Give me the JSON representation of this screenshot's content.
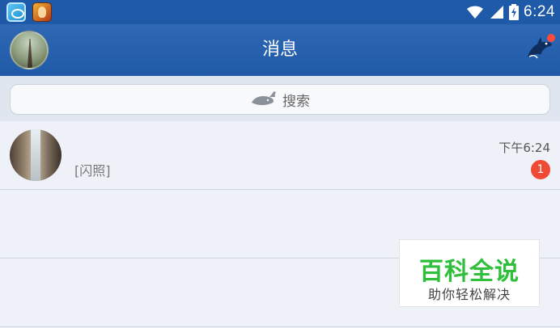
{
  "status_bar": {
    "time": "6:24",
    "apps": [
      "app-icon-1",
      "app-icon-2"
    ]
  },
  "header": {
    "title": "消息"
  },
  "search": {
    "label": "搜索"
  },
  "messages": [
    {
      "preview": "[闪照]",
      "time": "下午6:24",
      "unread": "1"
    }
  ],
  "watermark": {
    "title": "百科全说",
    "subtitle": "助你轻松解决"
  },
  "colors": {
    "header_bg": "#1f5aa8",
    "unread_badge": "#ef4a34",
    "watermark_green": "#2fbf3a"
  }
}
